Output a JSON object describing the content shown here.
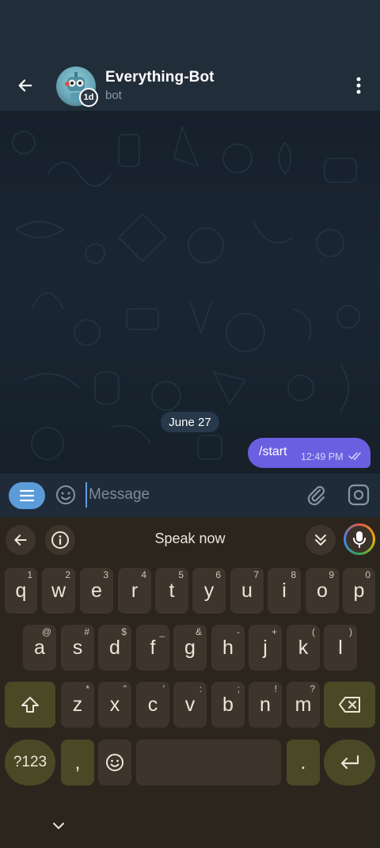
{
  "header": {
    "title": "Everything-Bot",
    "subtitle": "bot",
    "ttl_badge": "1d",
    "back_icon": "arrow-left-icon",
    "more_icon": "more-vertical-icon"
  },
  "chat": {
    "date_label": "June 27",
    "messages": [
      {
        "text": "/start",
        "time": "12:49 PM",
        "status": "read"
      }
    ]
  },
  "composer": {
    "placeholder": "Message",
    "value": ""
  },
  "keyboard": {
    "speak_label": "Speak now",
    "row1": [
      {
        "key": "q",
        "hint": "1"
      },
      {
        "key": "w",
        "hint": "2"
      },
      {
        "key": "e",
        "hint": "3"
      },
      {
        "key": "r",
        "hint": "4"
      },
      {
        "key": "t",
        "hint": "5"
      },
      {
        "key": "y",
        "hint": "6"
      },
      {
        "key": "u",
        "hint": "7"
      },
      {
        "key": "i",
        "hint": "8"
      },
      {
        "key": "o",
        "hint": "9"
      },
      {
        "key": "p",
        "hint": "0"
      }
    ],
    "row2": [
      {
        "key": "a",
        "hint": "@"
      },
      {
        "key": "s",
        "hint": "#"
      },
      {
        "key": "d",
        "hint": "$"
      },
      {
        "key": "f",
        "hint": "_"
      },
      {
        "key": "g",
        "hint": "&"
      },
      {
        "key": "h",
        "hint": "-"
      },
      {
        "key": "j",
        "hint": "+"
      },
      {
        "key": "k",
        "hint": "("
      },
      {
        "key": "l",
        "hint": ")"
      }
    ],
    "row3": [
      {
        "key": "z",
        "hint": "*"
      },
      {
        "key": "x",
        "hint": "\""
      },
      {
        "key": "c",
        "hint": "'"
      },
      {
        "key": "v",
        "hint": ":"
      },
      {
        "key": "b",
        "hint": ";"
      },
      {
        "key": "n",
        "hint": "!"
      },
      {
        "key": "m",
        "hint": "?"
      }
    ],
    "symbols_label": "?123",
    "comma_label": ",",
    "period_label": "."
  },
  "colors": {
    "header_bg": "#222d3a",
    "bubble_out": "#6a5fe0",
    "accent_blue": "#5b9bd9",
    "keyboard_bg": "#2b251e",
    "key_bg": "#3d352b",
    "key_accent": "#4a4925"
  }
}
